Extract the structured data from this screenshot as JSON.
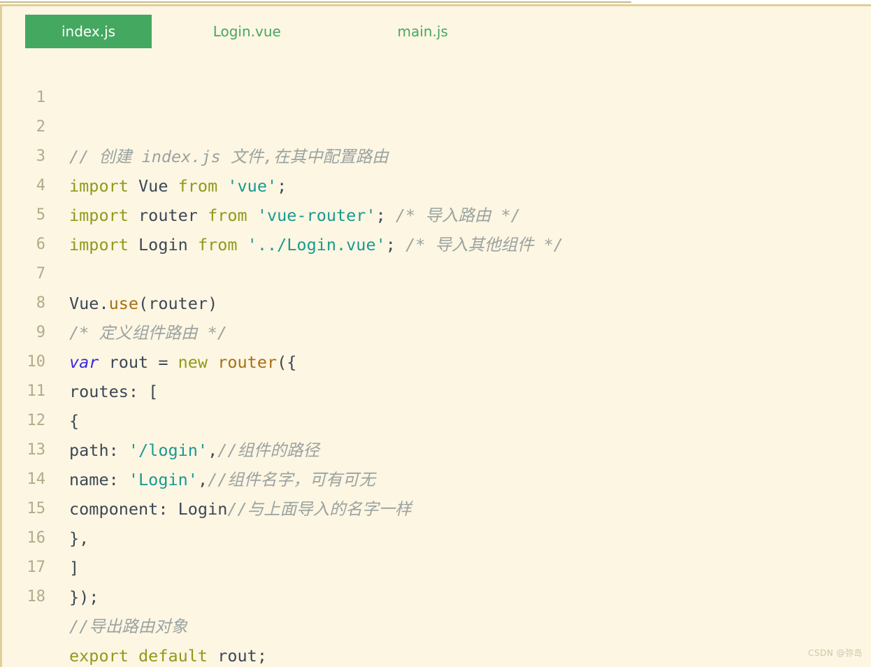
{
  "window": {
    "background_color": "#fdf6e3",
    "border_color": "#dfcf9a",
    "accent_color": "#45a860"
  },
  "tabs": [
    {
      "label": "index.js",
      "active": true,
      "name": "tab-index-js"
    },
    {
      "label": "Login.vue",
      "active": false,
      "name": "tab-login-vue"
    },
    {
      "label": "main.js",
      "active": false,
      "name": "tab-main-js"
    }
  ],
  "editor": {
    "language": "javascript",
    "line_numbers": [
      "1",
      "2",
      "3",
      "4",
      "5",
      "6",
      "7",
      "8",
      "9",
      "10",
      "11",
      "12",
      "13",
      "14",
      "15",
      "16",
      "17",
      "18"
    ],
    "lines": [
      {
        "n": "1",
        "text": "// 创建 index.js 文件,在其中配置路由"
      },
      {
        "n": "2",
        "text": "import Vue from 'vue';"
      },
      {
        "n": "3",
        "text": "import router from 'vue-router'; /* 导入路由 */"
      },
      {
        "n": "4",
        "text": "import Login from '../Login.vue'; /* 导入其他组件 */"
      },
      {
        "n": "5",
        "text": ""
      },
      {
        "n": "6",
        "text": "Vue.use(router)"
      },
      {
        "n": "7",
        "text": "/* 定义组件路由 */"
      },
      {
        "n": "8",
        "text": "var rout = new router({"
      },
      {
        "n": "9",
        "text": "routes: ["
      },
      {
        "n": "10",
        "text": "{"
      },
      {
        "n": "11",
        "text": "path: '/login',//组件的路径"
      },
      {
        "n": "12",
        "text": "name: 'Login',//组件名字，可有可无"
      },
      {
        "n": "13",
        "text": "component: Login//与上面导入的名字一样"
      },
      {
        "n": "14",
        "text": "},"
      },
      {
        "n": "15",
        "text": "]"
      },
      {
        "n": "16",
        "text": "});"
      },
      {
        "n": "17",
        "text": "//导出路由对象"
      },
      {
        "n": "18",
        "text": "export default rout;"
      }
    ],
    "tokens": {
      "l1_comment": "// 创建 index.js 文件,在其中配置路由",
      "l2_import": "import",
      "l2_vue": " Vue ",
      "l2_from": "from",
      "l2_string": " 'vue'",
      "l2_semi": ";",
      "l3_import": "import",
      "l3_router": " router ",
      "l3_from": "from",
      "l3_string": " 'vue-router'",
      "l3_semi": ";",
      "l3_comment": " /* 导入路由 */",
      "l4_import": "import",
      "l4_login": " Login ",
      "l4_from": "from",
      "l4_string": " '../Login.vue'",
      "l4_semi": ";",
      "l4_comment": " /* 导入其他组件 */",
      "l6_vue": "Vue.",
      "l6_use": "use",
      "l6_args": "(router)",
      "l7_comment": "/* 定义组件路由 */",
      "l8_var": "var",
      "l8_rout": " rout = ",
      "l8_new": "new",
      "l8_router": " router",
      "l8_open": "({",
      "l9_text": "routes: [",
      "l10_text": "{",
      "l11_key": "path: ",
      "l11_string": "'/login'",
      "l11_comma": ",",
      "l11_comment": "//组件的路径",
      "l12_key": "name: ",
      "l12_string": "'Login'",
      "l12_comma": ",",
      "l12_comment": "//组件名字，可有可无",
      "l13_key": "component: Login",
      "l13_comment": "//与上面导入的名字一样",
      "l14_text": "},",
      "l15_text": "]",
      "l16_text": "});",
      "l17_comment": "//导出路由对象",
      "l18_export": "export default",
      "l18_rout": " rout;"
    }
  },
  "watermark": {
    "text": "CSDN @弥岛"
  }
}
